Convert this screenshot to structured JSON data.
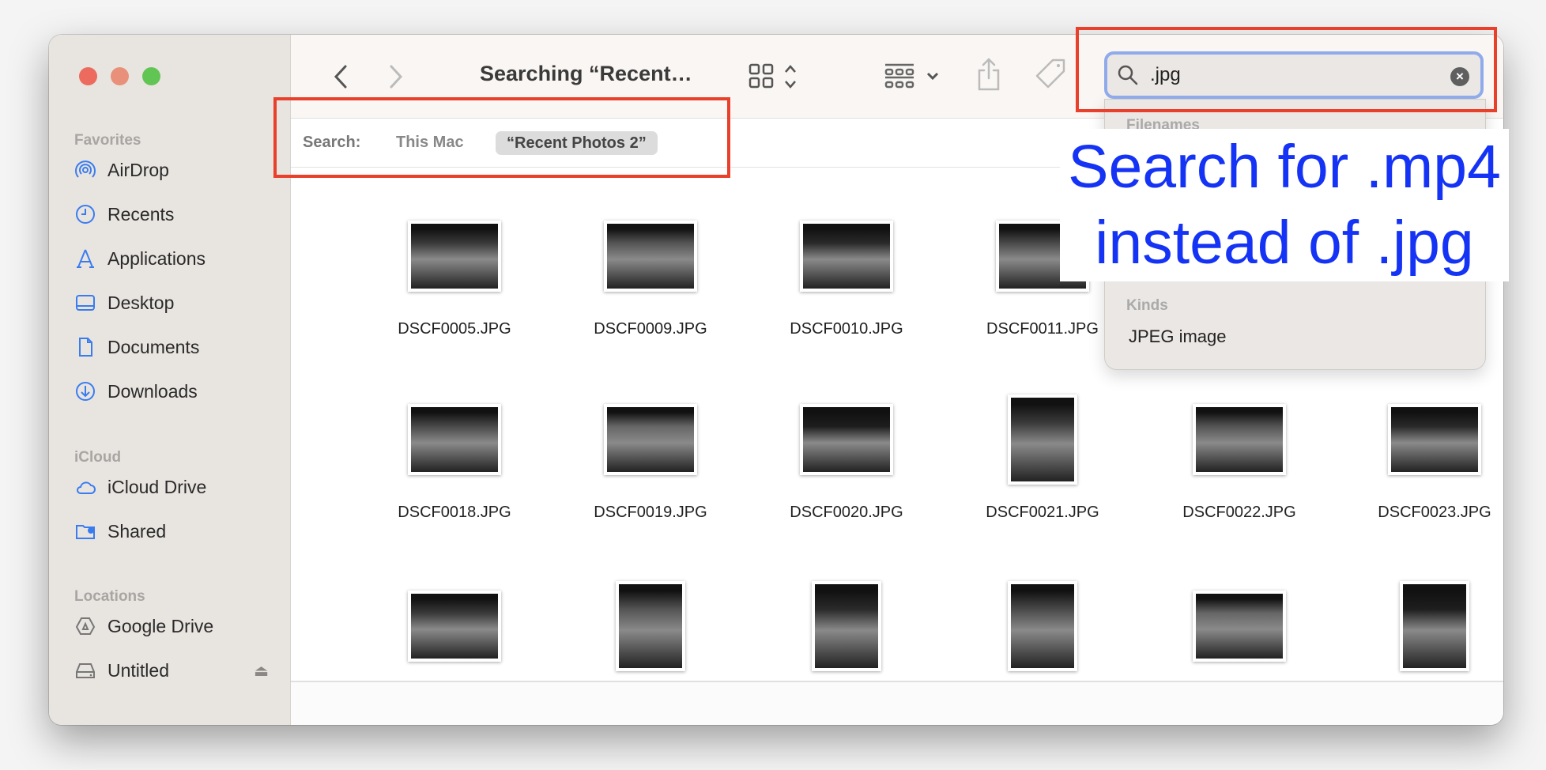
{
  "window": {
    "title": "Searching “Recent…"
  },
  "sidebar": {
    "sections": [
      {
        "label": "Favorites",
        "items": [
          {
            "label": "AirDrop",
            "icon": "airdrop-icon"
          },
          {
            "label": "Recents",
            "icon": "clock-icon"
          },
          {
            "label": "Applications",
            "icon": "applications-icon"
          },
          {
            "label": "Desktop",
            "icon": "desktop-icon"
          },
          {
            "label": "Documents",
            "icon": "document-icon"
          },
          {
            "label": "Downloads",
            "icon": "download-icon"
          }
        ]
      },
      {
        "label": "iCloud",
        "items": [
          {
            "label": "iCloud Drive",
            "icon": "cloud-icon"
          },
          {
            "label": "Shared",
            "icon": "shared-folder-icon"
          }
        ]
      },
      {
        "label": "Locations",
        "items": [
          {
            "label": "Google Drive",
            "icon": "google-drive-icon"
          },
          {
            "label": "Untitled",
            "icon": "drive-icon"
          }
        ]
      }
    ]
  },
  "scope": {
    "label": "Search:",
    "this_mac": "This Mac",
    "folder": "“Recent Photos 2”"
  },
  "search": {
    "value": ".jpg",
    "dropdown": {
      "filenames_header": "Filenames",
      "kinds_header": "Kinds",
      "kinds_item": "JPEG image"
    }
  },
  "annotation": {
    "line1": "Search for .mp4",
    "line2": "instead of .jpg",
    "color": "#1533f5",
    "box_color": "#e8402a"
  },
  "files": {
    "rows": [
      [
        {
          "name": "DSCF0005.JPG",
          "o": "l"
        },
        {
          "name": "DSCF0009.JPG",
          "o": "l"
        },
        {
          "name": "DSCF0010.JPG",
          "o": "l"
        },
        {
          "name": "DSCF0011.JPG",
          "o": "l"
        }
      ],
      [
        {
          "name": "DSCF0018.JPG",
          "o": "l"
        },
        {
          "name": "DSCF0019.JPG",
          "o": "l"
        },
        {
          "name": "DSCF0020.JPG",
          "o": "l"
        },
        {
          "name": "DSCF0021.JPG",
          "o": "p"
        },
        {
          "name": "DSCF0022.JPG",
          "o": "l"
        },
        {
          "name": "DSCF0023.JPG",
          "o": "l"
        }
      ],
      [
        {
          "o": "l"
        },
        {
          "o": "p"
        },
        {
          "o": "p"
        },
        {
          "o": "p"
        },
        {
          "o": "l"
        },
        {
          "o": "p"
        }
      ]
    ]
  }
}
